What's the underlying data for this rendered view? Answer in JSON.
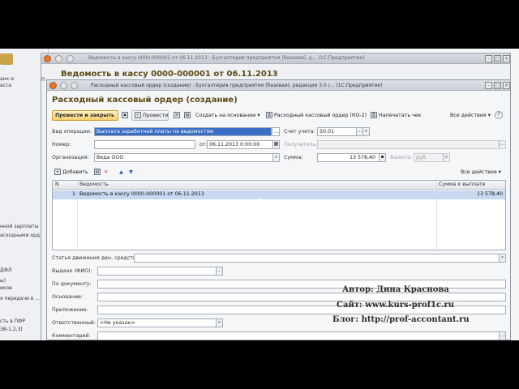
{
  "background_window": {
    "lines": [
      "анк и",
      "асса",
      "нной зарплаты",
      "асходными орд...",
      "ДФЛ",
      "ы)",
      "иков",
      "я передачи в ...",
      "сть в ПФР",
      "ЗВ-1,2,3)"
    ]
  },
  "middle_window": {
    "titlebar": "Ведомость в кассу 0000-000001 от 06.11.2013 : Бухгалтерия предприятия (базовая), р... (1С:Предприятие)",
    "title": "Ведомость в кассу 0000-000001 от 06.11.2013",
    "side_label": "П"
  },
  "front_window": {
    "titlebar": "Расходный кассовый ордер (создание) : Бухгалтерия предприятия (базовая), редакция 3.0 /... (1С:Предприятие)",
    "heading": "Расходный кассовый ордер (создание)",
    "toolbar": {
      "post_close": "Провести и закрыть",
      "post": "Провести",
      "create_based": "Создать на основании",
      "print_form": "Расходный кассовый ордер (КО-2)",
      "print_check": "Напечатать чек",
      "all_actions": "Все действия",
      "help": "?"
    },
    "form": {
      "op_type_label": "Вид операции:",
      "op_type_value": "Выплата заработной платы по ведомостям",
      "account_label": "Счет учета:",
      "account_value": "50.01",
      "number_label": "Номер:",
      "number_value": "",
      "from_label": "от:",
      "date_value": "06.11.2013  0:00:00",
      "recipient_label": "Получатель:",
      "org_label": "Организация:",
      "org_value": "Веда ООО",
      "sum_label": "Сумма:",
      "sum_value": "13 578,40",
      "currency_label": "Валюта:",
      "currency_value": "руб."
    },
    "table_toolbar": {
      "add": "Добавить",
      "all_actions": "Все действия"
    },
    "table": {
      "columns": [
        "N",
        "Ведомость",
        "Сумма к выплате"
      ],
      "rows": [
        {
          "n": "1",
          "doc": "Ведомость в кассу 0000-000001 от 06.11.2013",
          "sum": "13 578,40"
        }
      ]
    },
    "lower": {
      "cashflow_label": "Статья движения ден. средств:",
      "issued_label": "Выдано (ФИО):",
      "bydoc_label": "По документу:",
      "basis_label": "Основание:",
      "attach_label": "Приложение:",
      "resp_label": "Ответственный:",
      "resp_value": "<Не указан>",
      "comment_label": "Комментарий:"
    }
  },
  "watermark": {
    "author": "Автор: Дина Краснова",
    "site": "Сайт: www.kurs-prof1c.ru",
    "blog": "Блог: http://prof-accontant.ru"
  }
}
